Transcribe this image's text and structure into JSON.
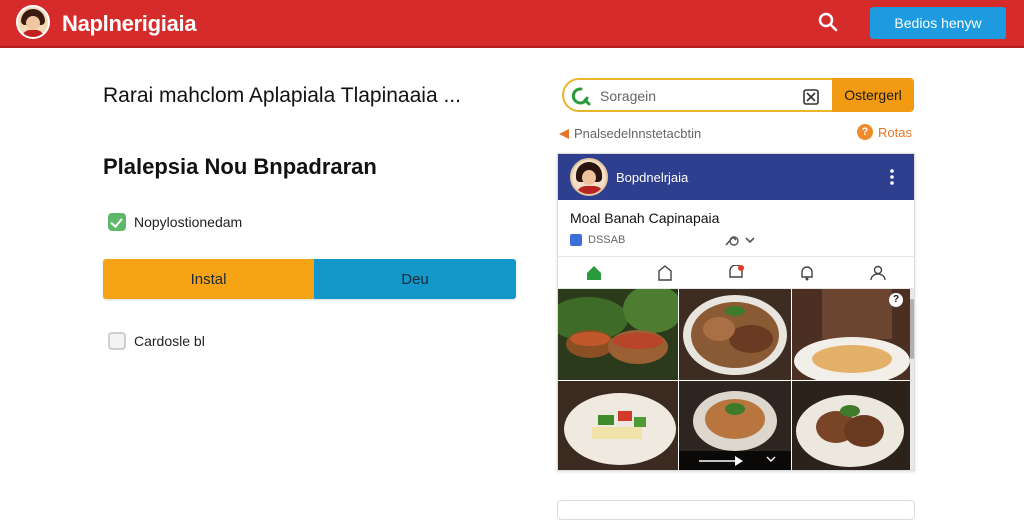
{
  "header": {
    "brand": "Naplnerigiaia",
    "cta_label": "Bedios henyw",
    "brand_color": "#d52b2b",
    "cta_color": "#1e9be0",
    "search_icon": "search-icon"
  },
  "main": {
    "headline": "Rarai mahclom Aplapiala Tlapinaaia ...",
    "subtitle": "Plalepsia Nou Bnpadraran",
    "checkbox1_label": "Nopylostionedam",
    "install_label": "Instal",
    "dev_label": "Deu",
    "checkbox2_label": "Cardosle  bl",
    "install_color": "#f6a415",
    "dev_color": "#1497c9"
  },
  "search": {
    "placeholder": "Soragein",
    "button_label": "Ostergerl",
    "accent": "#f39a13"
  },
  "notice": {
    "text": "Pnalsedelnnstetacbtin",
    "rates_badge": "?",
    "rates_label": "Rotas"
  },
  "card": {
    "author": "Bopdnelrjaia",
    "title": "Moal  Banah  Capinapaia",
    "meta": "DSSAB",
    "header_color": "#2f3f8f",
    "tabs": [
      "home-icon",
      "group-icon",
      "notification-badge-icon",
      "bell-icon",
      "profile-icon"
    ],
    "grid_badge": "?"
  }
}
